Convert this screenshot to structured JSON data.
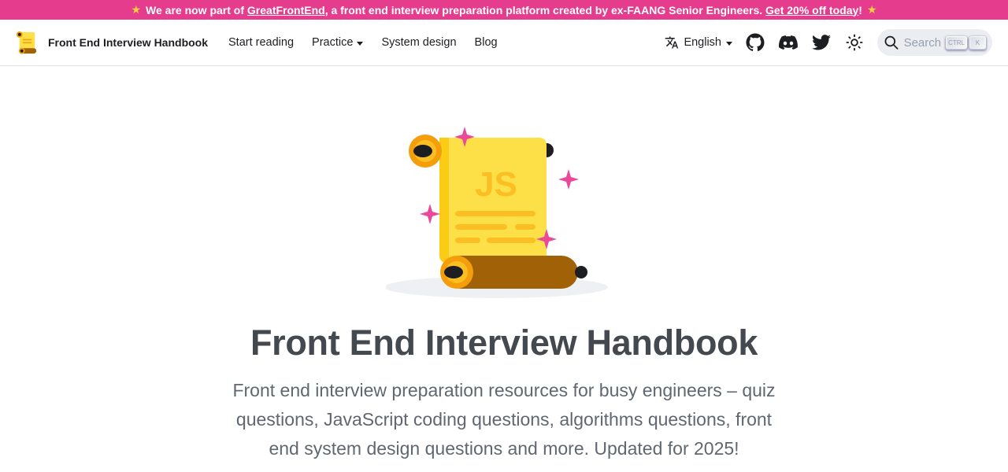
{
  "announcement": {
    "prefix": "We are now part of ",
    "link_label": "GreatFrontEnd",
    "middle": ", a front end interview preparation platform created by ex-FAANG Senior Engineers. ",
    "cta_label": "Get 20% off today",
    "suffix": "!",
    "star_icon": "star-icon",
    "bg_color": "#e63c8d"
  },
  "navbar": {
    "brand_title": "Front End Interview Handbook",
    "links": [
      {
        "label": "Start reading"
      },
      {
        "label": "Practice",
        "has_dropdown": true
      },
      {
        "label": "System design"
      },
      {
        "label": "Blog"
      }
    ],
    "language": {
      "label": "English",
      "icon": "translate-icon"
    },
    "social_icons": [
      "github-icon",
      "discord-icon",
      "twitter-icon"
    ],
    "theme_icon": "sun-icon",
    "search": {
      "placeholder": "Search",
      "keys": [
        "CTRL",
        "K"
      ]
    }
  },
  "hero": {
    "title": "Front End Interview Handbook",
    "subtitle": "Front end interview preparation resources for busy engineers – quiz questions, JavaScript coding questions, algorithms questions, front end system design questions and more. Updated for 2025!",
    "scroll_text": "JS"
  }
}
